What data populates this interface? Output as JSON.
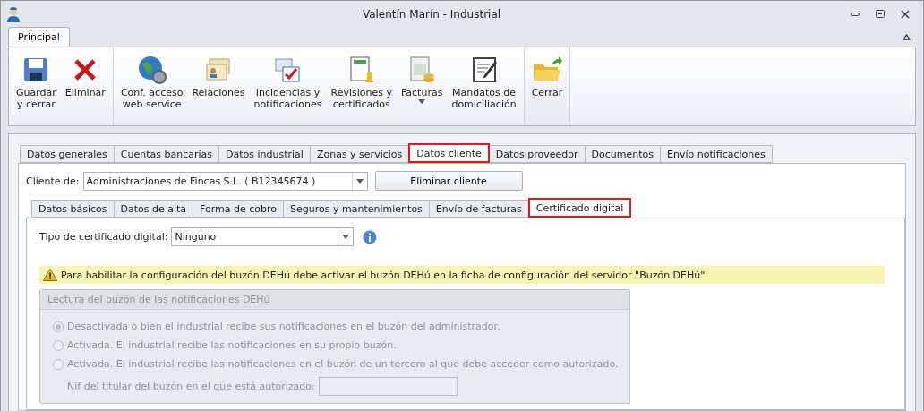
{
  "window": {
    "title": "Valentín Marín - Industrial"
  },
  "ribbon": {
    "tabs": [
      {
        "label": "Principal",
        "selected": true
      }
    ],
    "groups": [
      [
        {
          "label": "Guardar\ny cerrar"
        },
        {
          "label": "Eliminar"
        }
      ],
      [
        {
          "label": "Conf. acceso\nweb service"
        },
        {
          "label": "Relaciones"
        },
        {
          "label": "Incidencias y\nnotificaciones"
        },
        {
          "label": "Revisiones y\ncertificados"
        },
        {
          "label": "Facturas",
          "dropdown": true
        },
        {
          "label": "Mandatos de\ndomiciliación"
        }
      ],
      [
        {
          "label": "Cerrar"
        }
      ]
    ]
  },
  "tabs": [
    {
      "label": "Datos generales",
      "selected": false,
      "highlighted": false
    },
    {
      "label": "Cuentas bancarias",
      "selected": false,
      "highlighted": false
    },
    {
      "label": "Datos industrial",
      "selected": false,
      "highlighted": false
    },
    {
      "label": "Zonas y servicios",
      "selected": false,
      "highlighted": false
    },
    {
      "label": "Datos cliente",
      "selected": true,
      "highlighted": true
    },
    {
      "label": "Datos proveedor",
      "selected": false,
      "highlighted": false
    },
    {
      "label": "Documentos",
      "selected": false,
      "highlighted": false
    },
    {
      "label": "Envío notificaciones",
      "selected": false,
      "highlighted": false
    }
  ],
  "client": {
    "label": "Cliente de:",
    "value": "Administraciones de Fincas S.L. ( B12345674 )",
    "button": "Eliminar cliente"
  },
  "subtabs": [
    {
      "label": "Datos básicos",
      "selected": false,
      "highlighted": false
    },
    {
      "label": "Datos de alta",
      "selected": false,
      "highlighted": false
    },
    {
      "label": "Forma de cobro",
      "selected": false,
      "highlighted": false
    },
    {
      "label": "Seguros y mantenimientos",
      "selected": false,
      "highlighted": false
    },
    {
      "label": "Envío de facturas",
      "selected": false,
      "highlighted": false
    },
    {
      "label": "Certificado digital",
      "selected": true,
      "highlighted": true
    }
  ],
  "certificate": {
    "label": "Tipo de certificado digital:",
    "value": "Ninguno"
  },
  "warning": "Para habilitar la configuración del buzón DEHú debe activar el buzón DEHú en la ficha de configuración del servidor \"Buzón DEHú\"",
  "group": {
    "title": "Lectura del buzón de las notificaciones DEHú",
    "disabled": true,
    "options": [
      {
        "label": "Desactivada o bien el industrial recibe sus notificaciones en el buzón del administrador.",
        "selected": true
      },
      {
        "label": "Activada. El industrial recibe las notificaciones en su propio buzón.",
        "selected": false
      },
      {
        "label": "Activada. El industrial recibe las notificaciones en el buzón de un tercero al que debe acceder como autorizado.",
        "selected": false
      }
    ],
    "nif_label": "Nif del titular del buzón en el que está autorizado:"
  }
}
